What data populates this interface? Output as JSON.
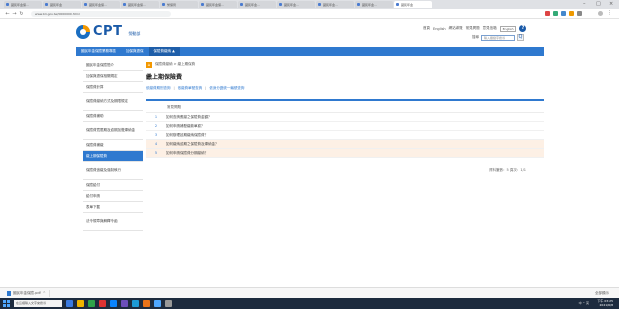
{
  "browser": {
    "tabs": [
      "國民年金保...",
      "國民年金",
      "國民年金保...",
      "國民年金保...",
      "勞保局",
      "國民年金保...",
      "國民年金...",
      "國民年金...",
      "國民年金...",
      "國民年金...",
      "國民年金"
    ],
    "active_tab_index": 10,
    "url": "www.bli.gov.tw/0000000.html",
    "window_controls": [
      "–",
      "□",
      "×"
    ]
  },
  "site": {
    "logo_text": "CPT",
    "logo_subtitle": "勞動部",
    "top_links": [
      "首頁",
      "English",
      "網站導覽",
      "常見問題",
      "意見信箱"
    ],
    "lang_button": "English",
    "search_label": "搜尋",
    "search_placeholder": "輸入關鍵字搜尋",
    "search_button": "Q",
    "help_icon": "?",
    "nav": [
      {
        "label": "國民年金保險業務專區",
        "active": false
      },
      {
        "label": "加保與退保",
        "active": false
      },
      {
        "label": "保險費繳納 ▲",
        "active": true
      }
    ]
  },
  "sidebar": {
    "items": [
      {
        "label": "國民年金保險簡介",
        "tall": false,
        "active": false
      },
      {
        "label": "加保與退保相關規定",
        "tall": false,
        "active": false
      },
      {
        "label": "保險費計算",
        "tall": false,
        "active": false
      },
      {
        "label": "保險費繳納方式及期限規定",
        "tall": true,
        "active": false
      },
      {
        "label": "保險費補助",
        "tall": false,
        "active": false
      },
      {
        "label": "保險費寬限期及逾期加徵滯納金",
        "tall": true,
        "active": false
      },
      {
        "label": "保險費補繳",
        "tall": false,
        "active": false
      },
      {
        "label": "繳上期保險費",
        "tall": false,
        "active": true
      },
      {
        "label": "保險費追繳及強制執行",
        "tall": true,
        "active": false
      },
      {
        "label": "保險給付",
        "tall": false,
        "active": false
      },
      {
        "label": "給付申請",
        "tall": false,
        "active": false
      },
      {
        "label": "表單下載",
        "tall": false,
        "active": false
      },
      {
        "label": "法令規章與解釋令函",
        "tall": true,
        "active": false
      }
    ]
  },
  "content": {
    "home_icon": "⌂",
    "breadcrumb": "保險費繳納 > 繳上期保費",
    "title": "繳上期保險費",
    "filters": [
      "依繳費期別查詢",
      "依繳費單號查詢",
      "依身分證統一編號查詢"
    ],
    "panel_header": "常見問題",
    "rows": [
      {
        "num": "1",
        "text": "如何查詢應繳之保險費金額？",
        "highlight": false
      },
      {
        "num": "2",
        "text": "如何申請補發繳款單據？",
        "highlight": false
      },
      {
        "num": "3",
        "text": "如何辦理延期繳納保險費？",
        "highlight": false
      },
      {
        "num": "4",
        "text": "如何繳納逾期之保險費及滯納金？",
        "highlight": true
      },
      {
        "num": "5",
        "text": "如何申請保險費分期繳納？",
        "highlight": true
      }
    ],
    "pager": "資料筆數：5 頁次：1/1"
  },
  "statusbar": {
    "download_name": "國民年金保險.pdf",
    "show_all": "全部顯示"
  },
  "taskbar": {
    "search_placeholder": "在這裡輸入文字來搜尋",
    "tray": "中 ^ 英",
    "time": "下午 03:25",
    "date": "2021/6/8",
    "app_colors": [
      "#3c7be0",
      "#f0b400",
      "#2fa34a",
      "#d33",
      "#0a84ff",
      "#6b4fbb",
      "#1c9ad6",
      "#e8731a",
      "#4fa8ff",
      "#999999"
    ],
    "start_color": "#4fa8ff"
  },
  "colors": {
    "brand_blue": "#2f79cf",
    "nav_active": "#1e5ea9",
    "accent_orange": "#f39800",
    "row_highlight": "#fdf0e5"
  }
}
